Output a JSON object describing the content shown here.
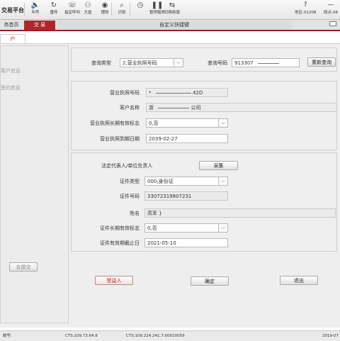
{
  "app": {
    "title": "交易平台"
  },
  "toolbar": {
    "buttons": [
      {
        "label": "叫号",
        "icon": "speaker-icon"
      },
      {
        "label": "重呼",
        "icon": "refresh-icon"
      },
      {
        "label": "指定呼叫",
        "icon": "phone-icon"
      },
      {
        "label": "大堂",
        "icon": "people-icon"
      },
      {
        "label": "理财",
        "icon": "coin-icon"
      },
      {
        "label": "识别",
        "icon": "scan-icon"
      },
      {
        "label": "暂停服务",
        "icon": "pause-icon"
      },
      {
        "label": "切换新版",
        "icon": "switch-icon"
      }
    ],
    "help_icon": "?",
    "region_label": "地区:01208",
    "network_label": "网点:08",
    "minimize_icon": "—"
  },
  "tabs": {
    "home": "务首页",
    "trade": "交 易",
    "shortcut": "自定义快捷键"
  },
  "subtab": {
    "label": "户"
  },
  "left_nav": {
    "item1": "客户信息",
    "item2": "签约信息",
    "resubmit": "去提交"
  },
  "query": {
    "type_label": "查询类型",
    "type_value": "2,营业执照号码",
    "number_label": "查询号码",
    "number_value": "913307",
    "requery": "重新查询"
  },
  "business": {
    "license_no_label": "营业执照号码",
    "license_no_value": "*",
    "license_no_suffix": "42D",
    "customer_name_label": "客户名称",
    "customer_name_value": "浙",
    "customer_name_suffix": "公司",
    "long_term_label": "营业执照长期有效标志",
    "long_term_value": "0,否",
    "expiry_label": "营业执照到期日期",
    "expiry_value": "2039-02-27"
  },
  "legal": {
    "section_label": "法定代表人/单位负责人",
    "collect": "采集",
    "id_type_label": "证件类型",
    "id_type_value": "000,身份证",
    "id_no_label": "证件号码",
    "id_no_value": "33072319807231",
    "name_label": "姓名",
    "name_value": "高军 }",
    "id_long_term_label": "证件长期有效标志",
    "id_long_term_value": "0,否",
    "id_expiry_label": "证件有效期截止日",
    "id_expiry_value": "2021-05-10"
  },
  "actions": {
    "beneficiary": "受益人",
    "confirm": "确定",
    "exit": "退出"
  },
  "status": {
    "teller": "统号:",
    "cts1": "CTS:109.73.64.8",
    "cts2": "CTS:109.224.241.7:00010059",
    "date": "2019-07"
  },
  "colors": {
    "accent": "#9c1c24",
    "tab_active": "#b2262b"
  }
}
